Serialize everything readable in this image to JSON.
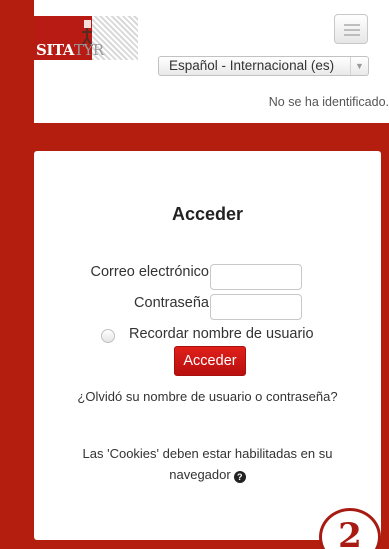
{
  "header": {
    "logo_text_a": "SITA",
    "logo_text_b": "TYR",
    "language_selected": "Español - Internacional (es)",
    "login_status": "No se ha identificado."
  },
  "login": {
    "title": "Acceder",
    "email_label": "Correo electrónico",
    "password_label": "Contraseña",
    "remember_label": "Recordar nombre de usuario",
    "submit_label": "Acceder",
    "forgot_text": "¿Olvidó su nombre de usuario o contraseña?",
    "cookies_text": "Las 'Cookies' deben estar habilitadas en su navegador",
    "help_icon_glyph": "?"
  },
  "step_badge": "2",
  "colors": {
    "brand_red": "#b41e0f",
    "button_red": "#c8150f",
    "panel_white": "#ffffff"
  }
}
